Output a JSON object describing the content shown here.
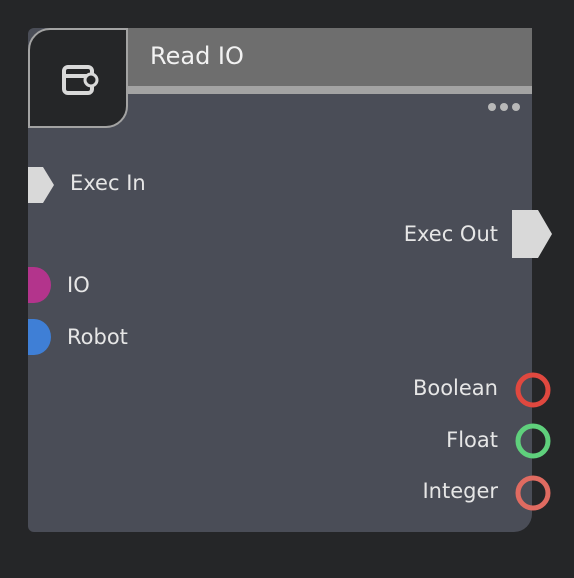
{
  "node": {
    "title": "Read IO",
    "icon": "node-function-icon",
    "menu_icon": "more-options-icon"
  },
  "pins": {
    "exec_in": {
      "label": "Exec In",
      "color": "#d9d9d9"
    },
    "exec_out": {
      "label": "Exec Out",
      "color": "#d9d9d9"
    },
    "io": {
      "label": "IO",
      "color": "#b3348c"
    },
    "robot": {
      "label": "Robot",
      "color": "#3f7fd6"
    },
    "boolean": {
      "label": "Boolean",
      "color": "#e0483f"
    },
    "float": {
      "label": "Float",
      "color": "#5fd07c"
    },
    "integer": {
      "label": "Integer",
      "color": "#e06b61"
    }
  },
  "colors": {
    "background": "#252628",
    "node_body": "#4a4d57",
    "title_bar": "#6e6e6e",
    "text": "#e6e6e6"
  }
}
